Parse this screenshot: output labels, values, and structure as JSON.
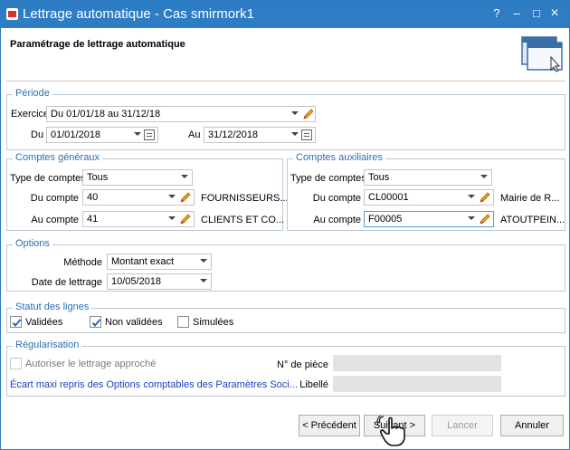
{
  "window": {
    "title": "Lettrage automatique - Cas smirmork1",
    "controls": {
      "help": "?",
      "minimize": "–",
      "maximize": "□",
      "close": "×"
    }
  },
  "header": {
    "page_title": "Paramétrage de lettrage automatique"
  },
  "periode": {
    "title": "Période",
    "exercice_label": "Exercice",
    "exercice_value": "Du 01/01/18 au 31/12/18",
    "du_label": "Du",
    "du_value": "01/01/2018",
    "au_label": "Au",
    "au_value": "31/12/2018"
  },
  "comptes_generaux": {
    "title": "Comptes généraux",
    "type_label": "Type de comptes",
    "type_value": "Tous",
    "du_label": "Du compte",
    "du_value": "40",
    "du_desc": "FOURNISSEURS...",
    "au_label": "Au compte",
    "au_value": "41",
    "au_desc": "CLIENTS ET CO..."
  },
  "comptes_auxiliaires": {
    "title": "Comptes auxiliaires",
    "type_label": "Type de comptes",
    "type_value": "Tous",
    "du_label": "Du compte",
    "du_value": "CL00001",
    "du_desc": "Mairie de R...",
    "au_label": "Au compte",
    "au_value": "F00005",
    "au_desc": "ATOUTPEIN..."
  },
  "options": {
    "title": "Options",
    "methode_label": "Méthode",
    "methode_value": "Montant exact",
    "date_label": "Date de lettrage",
    "date_value": "10/05/2018"
  },
  "statut": {
    "title": "Statut des lignes",
    "validees": {
      "label": "Validées",
      "checked": true
    },
    "non_validees": {
      "label": "Non validées",
      "checked": true
    },
    "simulees": {
      "label": "Simulées",
      "checked": false
    }
  },
  "regularisation": {
    "title": "Régularisation",
    "autoriser_label": "Autoriser le lettrage approché",
    "piece_label": "N° de pièce",
    "piece_value": "",
    "ecart_link": "Écart maxi repris des Options comptables des Paramètres Soci...",
    "libelle_label": "Libellé",
    "libelle_value": ""
  },
  "buttons": {
    "precedent": "< Précédent",
    "suivant": "Suivant >",
    "lancer": "Lancer",
    "annuler": "Annuler"
  },
  "colors": {
    "titlebar": "#2e7dc4",
    "group_title": "#2b6fb0",
    "link": "#1a3fbf"
  }
}
